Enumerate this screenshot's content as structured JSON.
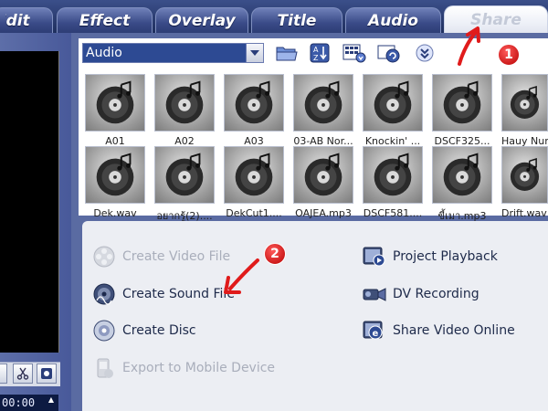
{
  "tabs": [
    {
      "id": "edit",
      "label": "Edit"
    },
    {
      "id": "effect",
      "label": "Effect"
    },
    {
      "id": "overlay",
      "label": "Overlay"
    },
    {
      "id": "title",
      "label": "Title"
    },
    {
      "id": "audio",
      "label": "Audio"
    },
    {
      "id": "share",
      "label": "Share"
    }
  ],
  "active_tab": "Share",
  "library": {
    "dropdown_value": "Audio",
    "row1": [
      "A01",
      "A02",
      "A03",
      "03-AB Nor...",
      "Knockin' ...",
      "DSCF325...",
      "Hauy Num"
    ],
    "row2": [
      "Dek.wav",
      "อยากรู้(2)....",
      "DekCut1....",
      "OAJEA.mp3",
      "DSCF581....",
      "ขี้เมา.mp3",
      "Drift.wav"
    ]
  },
  "tasks": {
    "left": [
      {
        "label": "Create Video File",
        "icon": "video-reel-icon",
        "disabled": true
      },
      {
        "label": "Create Sound File",
        "icon": "sound-disc-icon",
        "disabled": false
      },
      {
        "label": "Create Disc",
        "icon": "disc-icon",
        "disabled": false
      },
      {
        "label": "Export to Mobile Device",
        "icon": "mobile-device-icon",
        "disabled": true
      }
    ],
    "right": [
      {
        "label": "Project Playback",
        "icon": "playback-icon",
        "disabled": false
      },
      {
        "label": "DV Recording",
        "icon": "camcorder-icon",
        "disabled": false
      },
      {
        "label": "Share Video Online",
        "icon": "online-share-icon",
        "disabled": false
      }
    ]
  },
  "annotations": {
    "badge1": "1",
    "badge2": "2"
  },
  "timecode": "00:00"
}
